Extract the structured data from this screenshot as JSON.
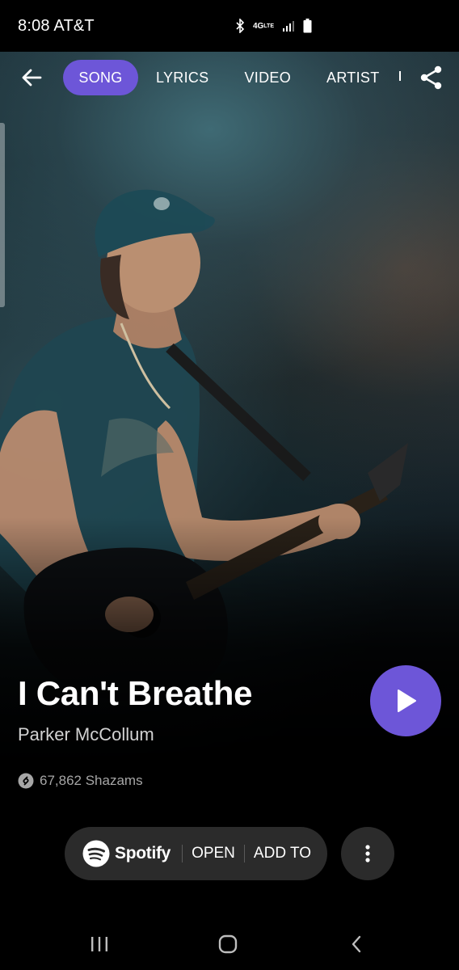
{
  "status_bar": {
    "time": "8:08",
    "carrier": "AT&T",
    "network_label": "4G",
    "network_sub": "LTE",
    "icons": [
      "bluetooth-icon",
      "signal-icon",
      "battery-icon"
    ]
  },
  "nav": {
    "tabs": [
      "SONG",
      "LYRICS",
      "VIDEO",
      "ARTIST"
    ],
    "active_tab": "SONG",
    "icons": {
      "back": "arrow-left-icon",
      "share": "share-icon"
    }
  },
  "song": {
    "title": "I Can't Breathe",
    "artist": "Parker McCollum",
    "shazam_count": "67,862 Shazams"
  },
  "provider": {
    "name": "Spotify",
    "open_label": "OPEN",
    "add_label": "ADD TO"
  },
  "colors": {
    "accent": "#6d56d8",
    "pill_bg": "#2b2b2b",
    "background": "#000000"
  }
}
